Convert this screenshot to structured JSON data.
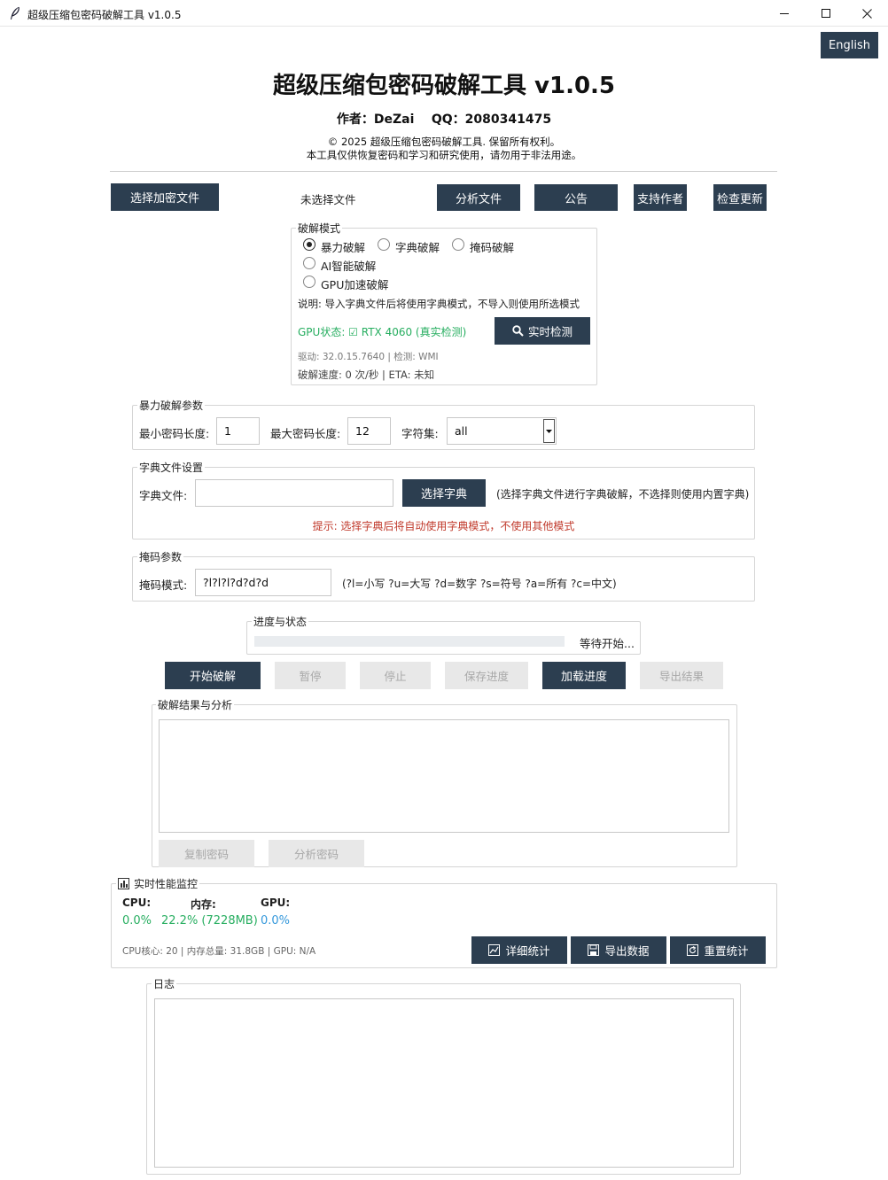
{
  "window": {
    "title": "超级压缩包密码破解工具 v1.0.5",
    "controls": [
      "minimize",
      "maximize",
      "close"
    ]
  },
  "language_button": "English",
  "header": {
    "title": "超级压缩包密码破解工具 v1.0.5",
    "author_line": "作者：DeZai    QQ：2080341475",
    "copyright": "© 2025 超级压缩包密码破解工具. 保留所有权利。",
    "disclaimer": "本工具仅供恢复密码和学习和研究使用，请勿用于非法用途。"
  },
  "file_row": {
    "select_button": "选择加密文件",
    "file_status": "未选择文件",
    "analyze_button": "分析文件",
    "notice_button": "公告",
    "support_button": "支持作者",
    "update_button": "检查更新"
  },
  "mode_group": {
    "label": "破解模式",
    "options": [
      {
        "label": "暴力破解",
        "checked": true
      },
      {
        "label": "字典破解",
        "checked": false
      },
      {
        "label": "掩码破解",
        "checked": false
      },
      {
        "label": "AI智能破解",
        "checked": false
      },
      {
        "label": "GPU加速破解",
        "checked": false
      }
    ],
    "note": "说明: 导入字典文件后将使用字典模式，不导入则使用所选模式",
    "gpu_status": "GPU状态: ☑ RTX 4060 (真实检测)",
    "detect_button": "实时检测",
    "driver_info": "驱动: 32.0.15.7640 | 检测: WMI",
    "speed_info": "破解速度: 0 次/秒 | ETA: 未知"
  },
  "brute_group": {
    "label": "暴力破解参数",
    "min_label": "最小密码长度:",
    "min_value": "1",
    "max_label": "最大密码长度:",
    "max_value": "12",
    "charset_label": "字符集:",
    "charset_value": "all"
  },
  "dict_group": {
    "label": "字典文件设置",
    "file_label": "字典文件:",
    "file_value": "",
    "select_button": "选择字典",
    "hint": "(选择字典文件进行字典破解，不选择则使用内置字典)",
    "warning": "提示: 选择字典后将自动使用字典模式，不使用其他模式"
  },
  "mask_group": {
    "label": "掩码参数",
    "mask_label": "掩码模式:",
    "mask_value": "?l?l?l?d?d?d",
    "legend": "(?l=小写 ?u=大写 ?d=数字 ?s=符号 ?a=所有 ?c=中文)"
  },
  "progress_group": {
    "label": "进度与状态",
    "progress": 0,
    "status": "等待开始..."
  },
  "actions": {
    "start": "开始破解",
    "pause": "暂停",
    "stop": "停止",
    "save": "保存进度",
    "load": "加载进度",
    "export": "导出结果"
  },
  "result_group": {
    "label": "破解结果与分析",
    "content": "",
    "copy_button": "复制密码",
    "analyze_button": "分析密码"
  },
  "perf_group": {
    "label": "实时性能监控",
    "cpu_label": "CPU:",
    "cpu_value": "0.0%",
    "mem_label": "内存:",
    "mem_value": "22.2% (7228MB)",
    "gpu_label": "GPU:",
    "gpu_value": "0.0%",
    "sys_info": "CPU核心: 20 | 内存总量: 31.8GB | GPU: N/A",
    "detail_button": "详细统计",
    "export_button": "导出数据",
    "reset_button": "重置统计"
  },
  "log_group": {
    "label": "日志",
    "content": ""
  },
  "colors": {
    "dark_button": "#2c3e50",
    "disabled_button": "#e8e8e8",
    "green": "#27ae60",
    "blue": "#3498db",
    "warning_red": "#c0392b"
  }
}
